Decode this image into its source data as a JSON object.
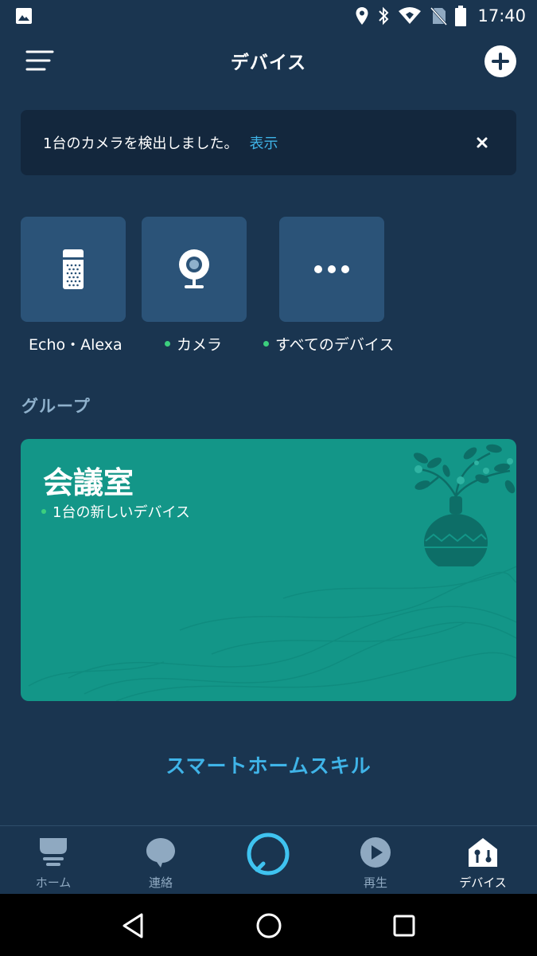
{
  "status_bar": {
    "time": "17:40"
  },
  "header": {
    "title": "デバイス"
  },
  "banner": {
    "message": "1台のカメラを検出しました。",
    "link": "表示"
  },
  "device_tiles": [
    {
      "label": "Echo・Alexa",
      "icon": "speaker-icon",
      "has_dot": false
    },
    {
      "label": "カメラ",
      "icon": "camera-icon",
      "has_dot": true
    },
    {
      "label": "すべてのデバイス",
      "icon": "more-icon",
      "has_dot": true
    }
  ],
  "groups": {
    "section_title": "グループ",
    "card": {
      "name": "会議室",
      "subtitle": "1台の新しいデバイス"
    }
  },
  "skill_link": "スマートホームスキル",
  "bottom_nav": [
    {
      "label": "ホーム",
      "icon": "home-icon"
    },
    {
      "label": "連絡",
      "icon": "chat-icon"
    },
    {
      "label": "",
      "icon": "alexa-icon"
    },
    {
      "label": "再生",
      "icon": "play-icon"
    },
    {
      "label": "デバイス",
      "icon": "devices-icon",
      "active": true
    }
  ],
  "colors": {
    "background": "#1a3550",
    "banner_bg": "#13273d",
    "tile_bg": "#2b5378",
    "accent": "#3fb4e8",
    "group_card": "#139688",
    "status_dot": "#3ccf7e"
  }
}
